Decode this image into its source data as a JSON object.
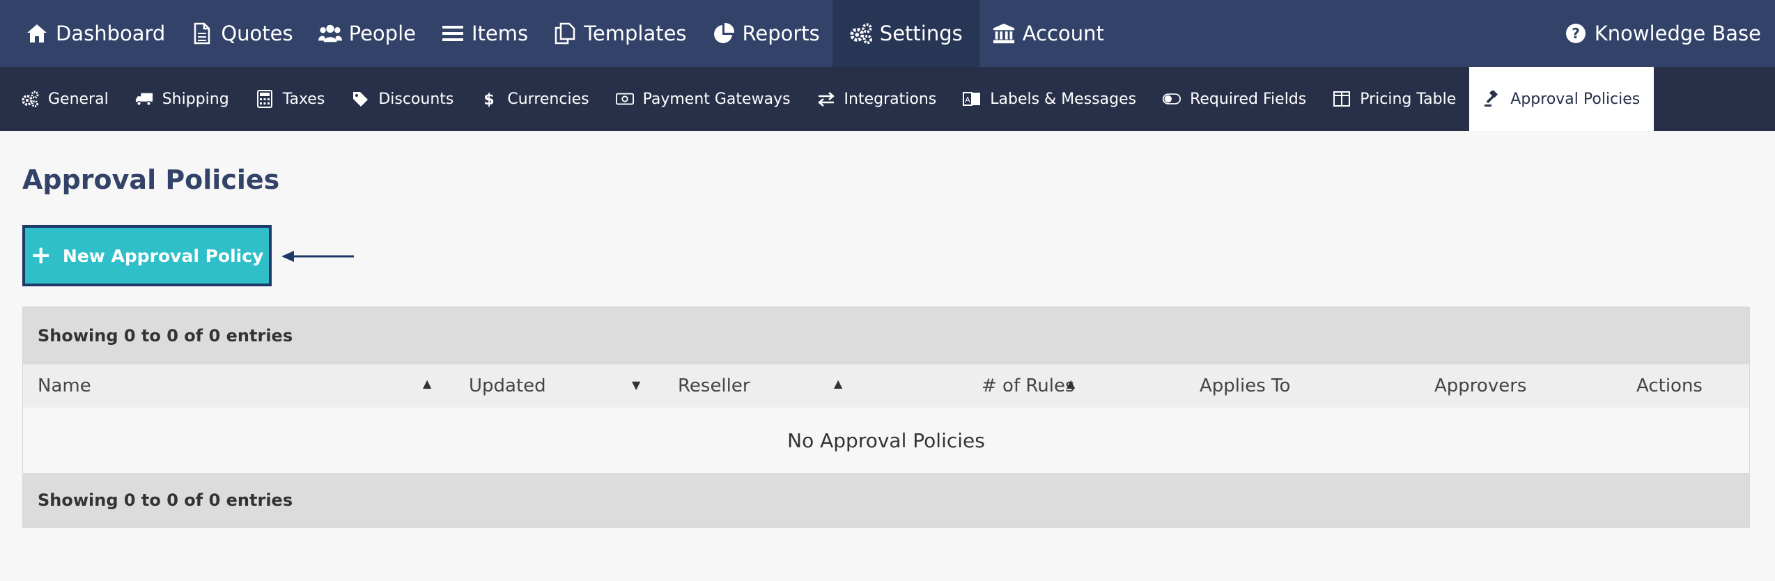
{
  "topnav": {
    "items": [
      {
        "label": "Dashboard",
        "icon": "home-icon"
      },
      {
        "label": "Quotes",
        "icon": "document-icon"
      },
      {
        "label": "People",
        "icon": "users-icon"
      },
      {
        "label": "Items",
        "icon": "list-icon"
      },
      {
        "label": "Templates",
        "icon": "copy-icon"
      },
      {
        "label": "Reports",
        "icon": "pie-chart-icon"
      },
      {
        "label": "Settings",
        "icon": "gears-icon",
        "active": true
      },
      {
        "label": "Account",
        "icon": "bank-icon"
      }
    ],
    "help": {
      "label": "Knowledge Base",
      "icon": "question-circle-icon"
    }
  },
  "subnav": {
    "items": [
      {
        "label": "General",
        "icon": "gears-icon"
      },
      {
        "label": "Shipping",
        "icon": "truck-icon"
      },
      {
        "label": "Taxes",
        "icon": "calculator-icon"
      },
      {
        "label": "Discounts",
        "icon": "tag-icon"
      },
      {
        "label": "Currencies",
        "icon": "dollar-icon"
      },
      {
        "label": "Payment Gateways",
        "icon": "money-bill-icon"
      },
      {
        "label": "Integrations",
        "icon": "exchange-icon"
      },
      {
        "label": "Labels & Messages",
        "icon": "language-icon"
      },
      {
        "label": "Required Fields",
        "icon": "toggle-icon"
      },
      {
        "label": "Pricing Table",
        "icon": "columns-icon"
      },
      {
        "label": "Approval Policies",
        "icon": "gavel-icon",
        "active": true
      }
    ]
  },
  "page": {
    "title": "Approval Policies",
    "new_button": "New Approval Policy"
  },
  "table": {
    "summary_top": "Showing 0 to 0 of 0 entries",
    "summary_bottom": "Showing 0 to 0 of 0 entries",
    "columns": [
      "Name",
      "Updated",
      "Reseller",
      "# of Rules",
      "Applies To",
      "Approvers",
      "Actions"
    ],
    "empty_message": "No Approval Policies"
  },
  "colors": {
    "topnav_bg": "#324268",
    "subnav_bg": "#283049",
    "button_bg": "#2fbfc9",
    "title": "#324268"
  }
}
